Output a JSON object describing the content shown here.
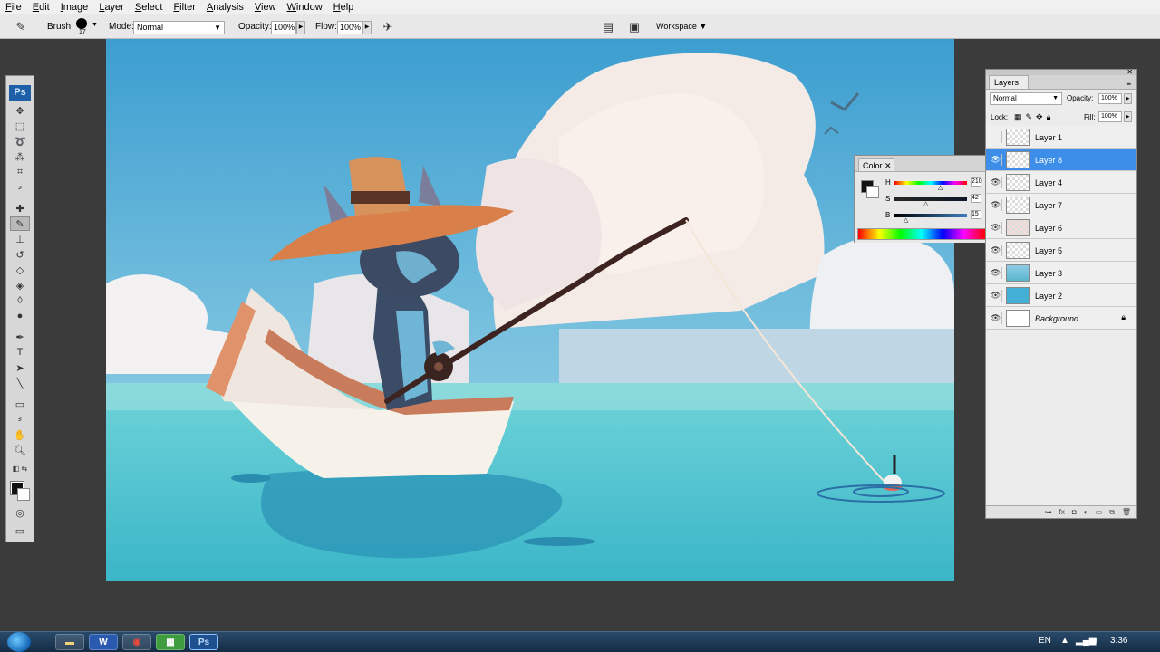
{
  "menu": [
    "File",
    "Edit",
    "Image",
    "Layer",
    "Select",
    "Filter",
    "Analysis",
    "View",
    "Window",
    "Help"
  ],
  "options": {
    "brush_label": "Brush:",
    "brush_size": "17",
    "mode_label": "Mode:",
    "mode_value": "Normal",
    "opacity_label": "Opacity:",
    "opacity_value": "100%",
    "flow_label": "Flow:",
    "flow_value": "100%",
    "workspace_label": "Workspace"
  },
  "tools": {
    "logo": "Ps"
  },
  "color_panel": {
    "tab": "Color",
    "h_label": "H",
    "h_value": "210",
    "s_label": "S",
    "s_value": "42",
    "b_label": "B",
    "b_value": "15"
  },
  "layers_panel": {
    "tab": "Layers",
    "blend_mode": "Normal",
    "opacity_label": "Opacity:",
    "opacity_value": "100%",
    "lock_label": "Lock:",
    "fill_label": "Fill:",
    "fill_value": "100%",
    "layers": [
      {
        "name": "Layer 1",
        "visible": false,
        "selected": false
      },
      {
        "name": "Layer 8",
        "visible": true,
        "selected": true
      },
      {
        "name": "Layer 4",
        "visible": true,
        "selected": false
      },
      {
        "name": "Layer 7",
        "visible": true,
        "selected": false
      },
      {
        "name": "Layer 6",
        "visible": true,
        "selected": false
      },
      {
        "name": "Layer 5",
        "visible": true,
        "selected": false
      },
      {
        "name": "Layer 3",
        "visible": true,
        "selected": false
      },
      {
        "name": "Layer 2",
        "visible": true,
        "selected": false
      },
      {
        "name": "Background",
        "visible": true,
        "selected": false,
        "locked": true
      }
    ]
  },
  "taskbar": {
    "language": "EN",
    "clock": "3:36"
  }
}
